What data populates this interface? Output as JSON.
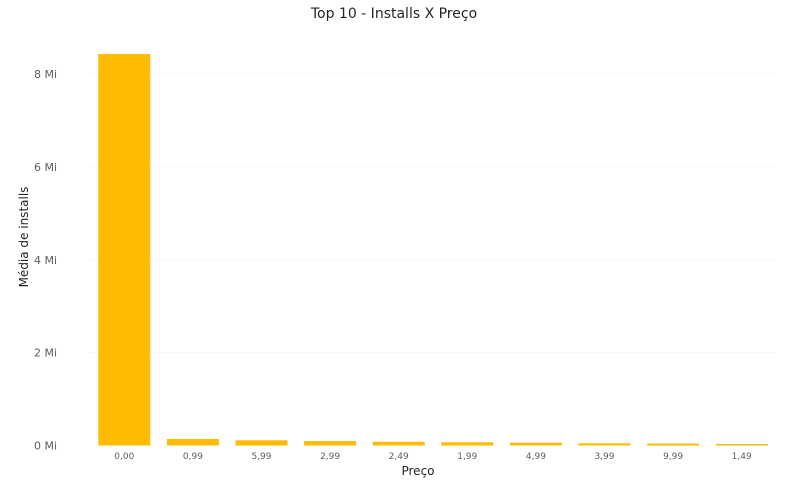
{
  "chart_data": {
    "type": "bar",
    "title": "Top 10 - Installs X Preço",
    "xlabel": "Preço",
    "ylabel": "Média de installs",
    "categories": [
      "0,00",
      "0,99",
      "5,99",
      "2,99",
      "2,49",
      "1,99",
      "4,99",
      "3,99",
      "9,99",
      "1,49"
    ],
    "values": [
      8430000,
      140000,
      112000,
      95000,
      80000,
      70000,
      60000,
      48000,
      42000,
      32000
    ],
    "ylim": [
      0,
      8000000
    ],
    "yticks": [
      {
        "value": 0,
        "label": "0 Mi"
      },
      {
        "value": 2000000,
        "label": "2 Mi"
      },
      {
        "value": 4000000,
        "label": "4 Mi"
      },
      {
        "value": 6000000,
        "label": "6 Mi"
      },
      {
        "value": 8000000,
        "label": "8 Mi"
      }
    ],
    "bar_color": "#FFBB00",
    "grid": true,
    "legend": "none"
  }
}
